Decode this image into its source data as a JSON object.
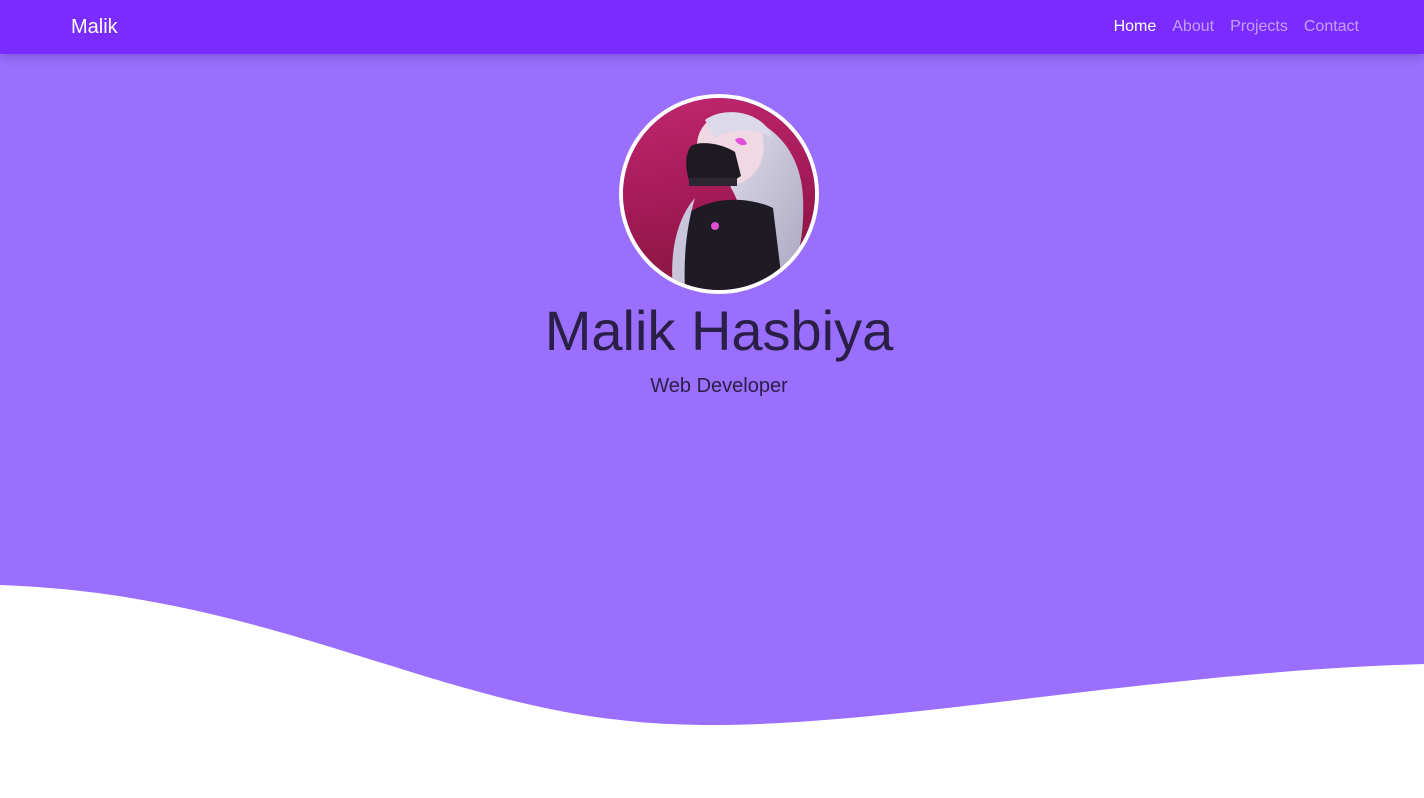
{
  "navbar": {
    "brand": "Malik",
    "links": [
      {
        "label": "Home",
        "active": true
      },
      {
        "label": "About",
        "active": false
      },
      {
        "label": "Projects",
        "active": false
      },
      {
        "label": "Contact",
        "active": false
      }
    ]
  },
  "hero": {
    "name": "Malik Hasbiya",
    "role": "Web Developer",
    "avatar_icon": "profile-picture-anime-character"
  },
  "colors": {
    "navbar": "#7a2bff",
    "hero": "#9a6ffe",
    "text": "#2a1f46",
    "page": "#ffffff"
  }
}
